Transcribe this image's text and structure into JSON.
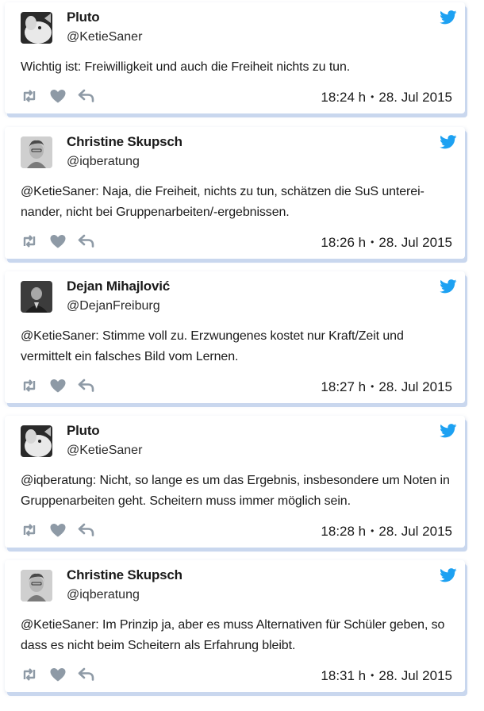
{
  "tweets": [
    {
      "name": "Pluto",
      "handle": "@KetieSaner",
      "avatar": "pluto-avatar",
      "text": "Wichtig ist: Freiwilligkeit und auch die Freiheit nichts zu tun.",
      "time": "18:24 h",
      "date": "28. Jul 2015"
    },
    {
      "name": "Christine Skupsch",
      "handle": "@iqberatung",
      "avatar": "christine-avatar",
      "text": "@KetieSaner: Naja, die Freiheit, nichts zu tun, schätzen die SuS unterei-nander, nicht bei Gruppenarbeiten/-ergebnissen.",
      "time": "18:26 h",
      "date": "28. Jul 2015"
    },
    {
      "name": "Dejan Mihajlović",
      "handle": "@DejanFreiburg",
      "avatar": "dejan-avatar",
      "text": "@KetieSaner: Stimme voll zu. Erzwungenes kostet nur Kraft/Zeit und vermittelt ein falsches Bild vom Lernen.",
      "time": "18:27 h",
      "date": "28. Jul 2015"
    },
    {
      "name": "Pluto",
      "handle": "@KetieSaner",
      "avatar": "pluto-avatar",
      "text": "@iqberatung: Nicht, so lange es um das Ergebnis, insbesondere um Noten in Gruppenarbeiten geht. Scheitern muss immer möglich sein.",
      "time": "18:28 h",
      "date": "28. Jul 2015"
    },
    {
      "name": "Christine Skupsch",
      "handle": "@iqberatung",
      "avatar": "christine-avatar",
      "text": "@KetieSaner: Im Prinzip ja, aber es muss Alternativen für Schüler geben, so dass es nicht beim Scheitern als Erfahrung bleibt.",
      "time": "18:31 h",
      "date": "28. Jul 2015"
    }
  ],
  "icons": {
    "brand": "twitter-bird-icon",
    "retweet": "retweet-icon",
    "like": "heart-icon",
    "reply": "reply-icon"
  },
  "colors": {
    "twitter_blue": "#1da1f2",
    "action_gray": "#8e9aa6",
    "card_shadow": "#c9d7ee"
  }
}
